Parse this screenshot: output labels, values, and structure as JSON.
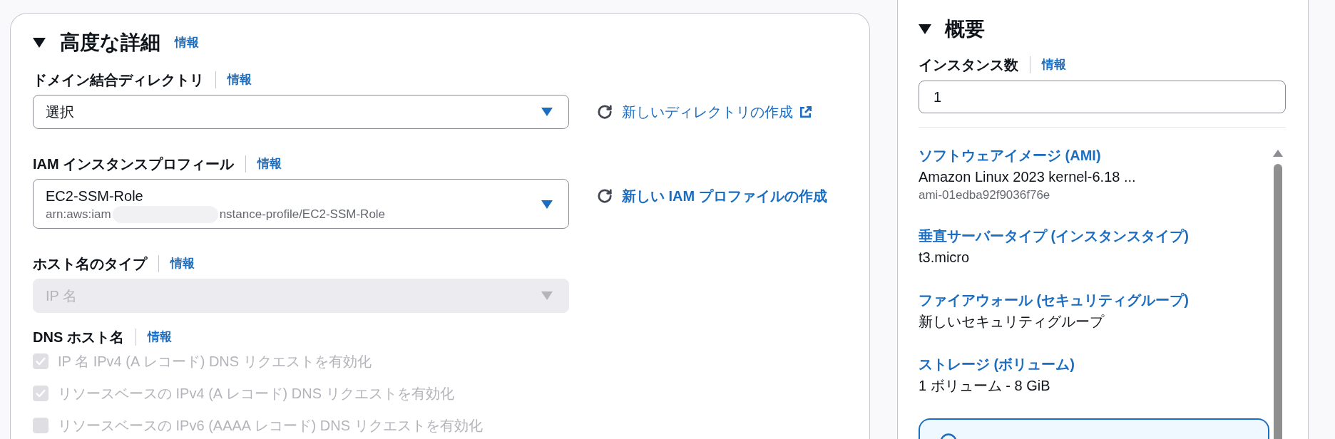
{
  "advanced_details": {
    "title": "高度な詳細",
    "expanded": true,
    "info_link": "情報",
    "fields": [
      {
        "kind": "select",
        "label": "ドメイン結合ディレクトリ",
        "info_link": "情報",
        "value": "選択",
        "disabled": false,
        "action": {
          "label": "新しいディレクトリの作成",
          "bold": false,
          "external": true
        }
      },
      {
        "kind": "select",
        "label": "IAM インスタンスプロフィール",
        "info_link": "情報",
        "value": "EC2-SSM-Role",
        "description": {
          "before": "arn:aws:iam",
          "redacted": true,
          "after": "nstance-profile/EC2-SSM-Role"
        },
        "disabled": false,
        "action": {
          "label": "新しい IAM プロファイルの作成",
          "bold": true,
          "external": false
        }
      },
      {
        "kind": "select",
        "label": "ホスト名のタイプ",
        "info_link": "情報",
        "value": "IP 名",
        "disabled": true
      },
      {
        "kind": "checkbox_group",
        "label": "DNS ホスト名",
        "info_link": "情報",
        "options": [
          {
            "label": "IP 名 IPv4 (A レコード) DNS リクエストを有効化",
            "checked": true,
            "disabled": true
          },
          {
            "label": "リソースベースの IPv4 (A レコード) DNS リクエストを有効化",
            "checked": true,
            "disabled": true
          },
          {
            "label": "リソースベースの IPv6 (AAAA レコード) DNS リクエストを有効化",
            "checked": false,
            "disabled": true
          }
        ]
      }
    ]
  },
  "summary": {
    "title": "概要",
    "expanded": true,
    "instance_count": {
      "label": "インスタンス数",
      "info_link": "情報",
      "value": "1"
    },
    "items": [
      {
        "title": "ソフトウェアイメージ (AMI)",
        "value": "Amazon Linux 2023 kernel-6.18 ...",
        "detail": "ami-01edba92f9036f76e"
      },
      {
        "title": "垂直サーバータイプ (インスタンスタイプ)",
        "value": "t3.micro"
      },
      {
        "title": "ファイアウォール (セキュリティグループ)",
        "value": "新しいセキュリティグループ"
      },
      {
        "title": "ストレージ (ボリューム)",
        "value": "1 ボリューム - 8 GiB"
      }
    ],
    "alert": {
      "kind": "info"
    }
  }
}
